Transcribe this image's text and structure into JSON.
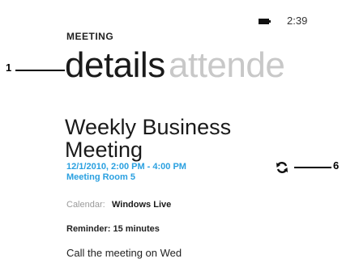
{
  "status_bar": {
    "time": "2:39",
    "battery_icon": "battery-icon"
  },
  "app": {
    "title": "MEETING"
  },
  "pivot": {
    "active": "details",
    "inactive": "attende"
  },
  "meeting": {
    "title_line1": "Weekly Business",
    "title_line2": "Meeting",
    "when": "12/1/2010, 2:00 PM - 4:00 PM",
    "location": "Meeting Room 5",
    "calendar_label": "Calendar:",
    "calendar_value": "Windows Live",
    "reminder": "Reminder: 15 minutes",
    "notes": "Call the meeting on Wed"
  },
  "callouts": {
    "one": "1",
    "six": "6"
  },
  "icons": {
    "sync": "sync-icon"
  },
  "colors": {
    "accent": "#2aa0e0",
    "inactive_pivot": "#c8c8c8"
  }
}
